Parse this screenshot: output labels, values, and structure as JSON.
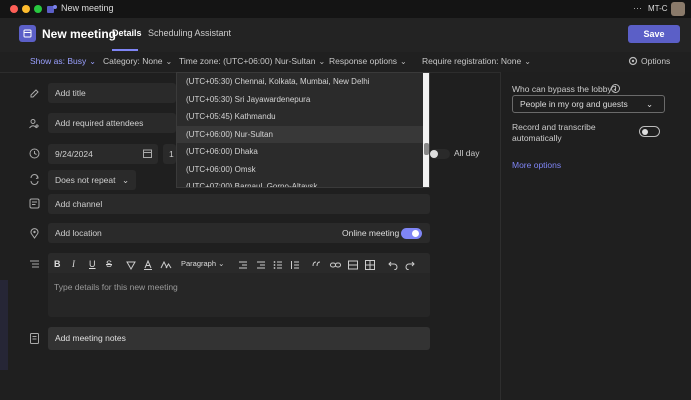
{
  "window": {
    "title": "New meeting",
    "user_initials": "MT-C",
    "more_label": "···"
  },
  "header": {
    "title": "New meeting",
    "tabs": [
      "Details",
      "Scheduling Assistant"
    ],
    "save_label": "Save"
  },
  "toolbar": {
    "show_as": "Show as: Busy",
    "category": "Category: None",
    "time_zone": "Time zone: (UTC+06:00) Nur-Sultan",
    "response_options": "Response options",
    "require_registration": "Require registration: None",
    "options": "Options"
  },
  "form": {
    "title_placeholder": "Add title",
    "attendees_placeholder": "Add required attendees",
    "start_date": "9/24/2024",
    "end_date_partial": "1",
    "all_day": "All day",
    "repeat": "Does not repeat",
    "channel_placeholder": "Add channel",
    "location_placeholder": "Add location",
    "online_meeting": "Online meeting",
    "online_meeting_on": true,
    "details_placeholder": "Type details for this new meeting",
    "meeting_notes": "Add meeting notes",
    "paragraph_label": "Paragraph",
    "format_buttons": [
      "B",
      "I",
      "U",
      "S"
    ]
  },
  "timezone_dropdown": {
    "items": [
      "(UTC+05:30) Chennai, Kolkata, Mumbai, New Delhi",
      "(UTC+05:30) Sri Jayawardenepura",
      "(UTC+05:45) Kathmandu",
      "(UTC+06:00) Nur-Sultan",
      "(UTC+06:00) Dhaka",
      "(UTC+06:00) Omsk",
      "(UTC+07:00) Barnaul, Gorno-Altaysk"
    ],
    "selected_index": 3
  },
  "right_panel": {
    "lobby_label": "Who can bypass the lobby?",
    "lobby_value": "People in my org and guests",
    "record_label_1": "Record and transcribe",
    "record_label_2": "automatically",
    "record_on": false,
    "more_options": "More options"
  },
  "colors": {
    "accent": "#5b5fc7",
    "link": "#7f85f5",
    "background": "#1f1f1f",
    "field": "#2a2a2a"
  }
}
